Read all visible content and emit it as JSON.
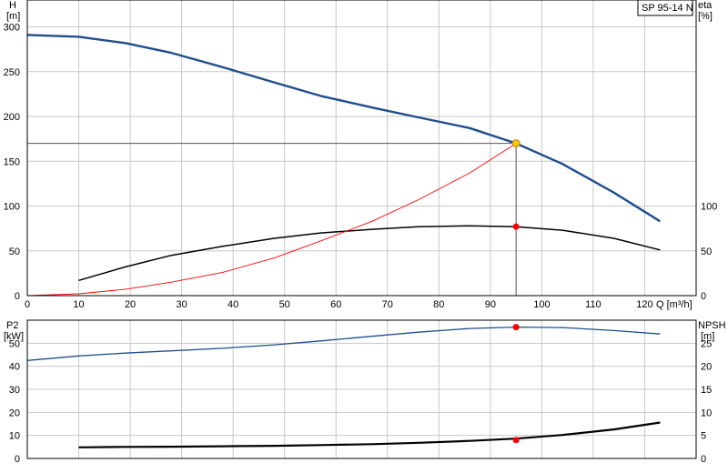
{
  "chart_data": {
    "type": "line",
    "model_label": "SP 95-14 N",
    "duty_point": {
      "q": 95,
      "h": 170,
      "eta": 77,
      "p2": 57,
      "npsh": 4
    },
    "top": {
      "axis_left": {
        "label_line1": "H",
        "label_line2": "[m]",
        "ticks": [
          0,
          50,
          100,
          150,
          200,
          250,
          300
        ],
        "ylim": [
          0,
          330
        ]
      },
      "axis_right": {
        "label_line1": "eta",
        "label_line2": "[%]",
        "ticks": [
          0,
          50,
          100
        ]
      },
      "axis_x": {
        "label": "Q [m³/h]",
        "ticks": [
          0,
          10,
          20,
          30,
          40,
          50,
          60,
          70,
          80,
          90,
          100,
          110,
          120
        ],
        "xlim": [
          0,
          130
        ]
      },
      "series": [
        {
          "id": "head",
          "color": "#1f4e8c",
          "width": 2.4,
          "points": [
            [
              0,
              291
            ],
            [
              10,
              289
            ],
            [
              19,
              282
            ],
            [
              28,
              271
            ],
            [
              38,
              255
            ],
            [
              48,
              238
            ],
            [
              57,
              223
            ],
            [
              67,
              210
            ],
            [
              76,
              199
            ],
            [
              86,
              187
            ],
            [
              95,
              170
            ],
            [
              104,
              147
            ],
            [
              114,
              115
            ],
            [
              123,
              83
            ]
          ]
        },
        {
          "id": "eta",
          "color": "#000000",
          "width": 1.5,
          "points": [
            [
              10,
              17
            ],
            [
              19,
              32
            ],
            [
              28,
              45
            ],
            [
              38,
              55
            ],
            [
              48,
              64
            ],
            [
              57,
              70
            ],
            [
              67,
              74
            ],
            [
              76,
              77
            ],
            [
              86,
              78
            ],
            [
              95,
              77
            ],
            [
              104,
              73
            ],
            [
              114,
              64
            ],
            [
              123,
              51
            ]
          ]
        },
        {
          "id": "system",
          "color": "#ff0000",
          "width": 0.9,
          "points": [
            [
              0,
              0
            ],
            [
              10,
              2
            ],
            [
              19,
              7
            ],
            [
              28,
              15
            ],
            [
              38,
              26
            ],
            [
              48,
              42
            ],
            [
              57,
              61
            ],
            [
              67,
              83
            ],
            [
              76,
              107
            ],
            [
              86,
              137
            ],
            [
              95,
              170
            ]
          ]
        }
      ]
    },
    "bottom": {
      "axis_left": {
        "label_line1": "P2",
        "label_line2": "[kW]",
        "ticks": [
          0,
          10,
          20,
          30,
          40,
          50
        ],
        "ylim": [
          0,
          60
        ]
      },
      "axis_right": {
        "label_line1": "NPSH",
        "label_line2": "[m]",
        "ticks": [
          0,
          5,
          10,
          15,
          20,
          25
        ]
      },
      "series": [
        {
          "id": "p2",
          "color": "#1f4e8c",
          "width": 1.3,
          "points": [
            [
              0,
              42.5
            ],
            [
              10,
              44.5
            ],
            [
              19,
              45.7
            ],
            [
              28,
              46.7
            ],
            [
              38,
              47.8
            ],
            [
              48,
              49.3
            ],
            [
              57,
              51
            ],
            [
              67,
              53
            ],
            [
              76,
              54.8
            ],
            [
              86,
              56.4
            ],
            [
              95,
              57
            ],
            [
              104,
              56.8
            ],
            [
              114,
              55.5
            ],
            [
              123,
              54
            ]
          ]
        },
        {
          "id": "npsh",
          "color": "#000000",
          "width": 2.2,
          "points": [
            [
              10,
              2.4
            ],
            [
              19,
              2.5
            ],
            [
              28,
              2.55
            ],
            [
              38,
              2.65
            ],
            [
              48,
              2.75
            ],
            [
              57,
              2.9
            ],
            [
              67,
              3.1
            ],
            [
              76,
              3.4
            ],
            [
              86,
              3.8
            ],
            [
              95,
              4.3
            ],
            [
              104,
              5.1
            ],
            [
              114,
              6.3
            ],
            [
              123,
              7.8
            ]
          ]
        }
      ]
    }
  }
}
